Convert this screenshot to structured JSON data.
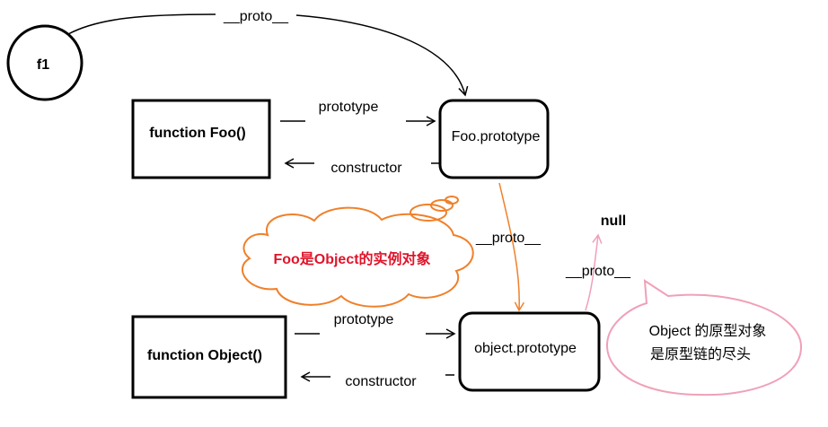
{
  "nodes": {
    "f1": "f1",
    "foo_function": "function Foo()",
    "foo_prototype": "Foo.prototype",
    "object_function": "function Object()",
    "object_prototype": "object.prototype",
    "null_node": "null"
  },
  "edges": {
    "f1_proto": "__proto__",
    "foo_prototype_link": "prototype",
    "foo_constructor_link": "constructor",
    "foo_proto_to_object": "__proto__",
    "object_prototype_link": "prototype",
    "object_constructor_link": "constructor",
    "object_proto_to_null": "__proto__"
  },
  "callouts": {
    "orange_thought": "Foo是Object的实例对象",
    "pink_bubble_line1": "Object 的原型对象",
    "pink_bubble_line2": "是原型链的尽头"
  },
  "colors": {
    "ink": "#000000",
    "orange": "#f0802a",
    "orange_text": "#e0142a",
    "pink": "#f0a0b8"
  }
}
